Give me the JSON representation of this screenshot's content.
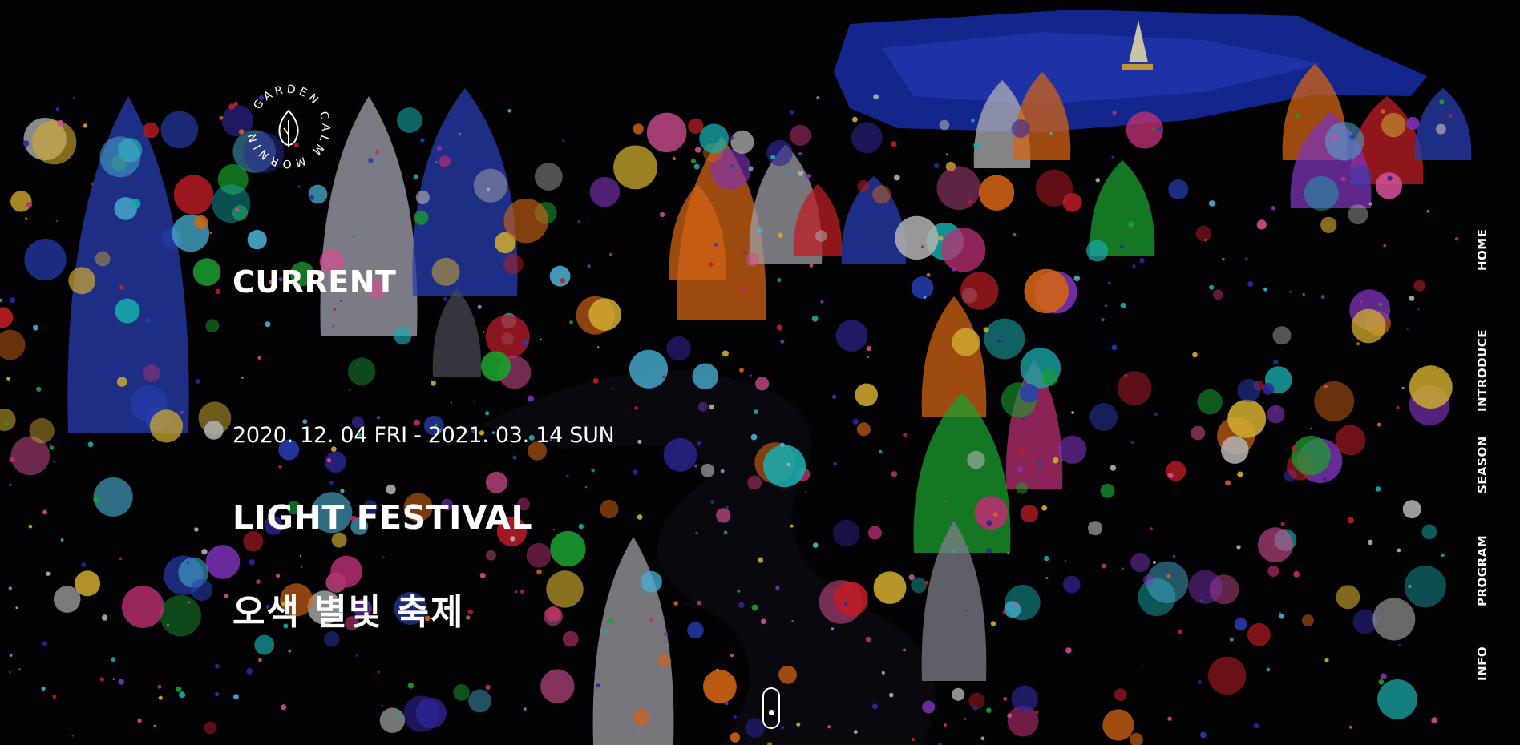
{
  "logo": {
    "brand_text": "GARDEN CALM MORNING",
    "icon": "leaf-icon"
  },
  "hero": {
    "section_label": "CURRENT",
    "date_range": "2020. 12. 04 FRI - 2021. 03. 14 SUN",
    "title_en": "LIGHT FESTIVAL",
    "title_ko": "오색 별빛 축제",
    "background_image": "night-light-festival-garden"
  },
  "side_nav": {
    "items": [
      {
        "label": "HOME"
      },
      {
        "label": "INTRODUCE"
      },
      {
        "label": "SEASON"
      },
      {
        "label": "PROGRAM"
      },
      {
        "label": "INFO"
      }
    ]
  },
  "scroll_indicator": {
    "icon": "mouse-scroll-icon"
  },
  "colors": {
    "text": "#ffffff",
    "background": "#05050a",
    "lake": "#1d36c8"
  }
}
